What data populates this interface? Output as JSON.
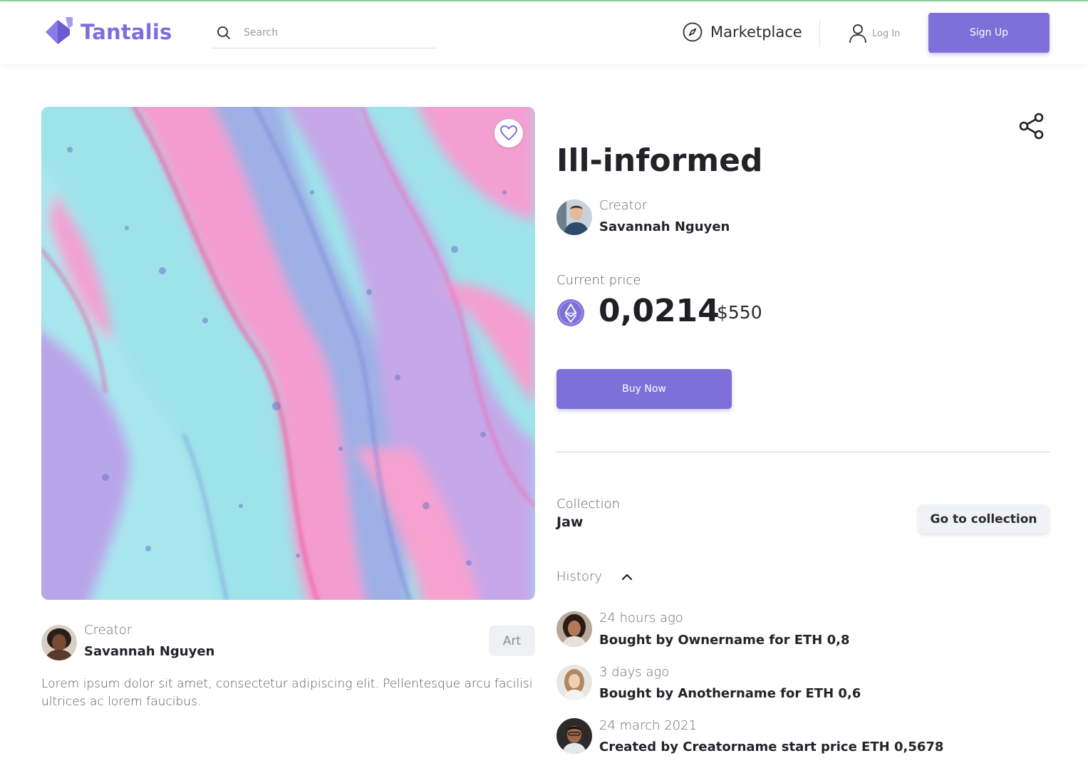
{
  "header": {
    "logo_text": "Tantalis",
    "search_placeholder": "Search",
    "nav_marketplace": "Marketplace",
    "login_label": "Log In",
    "signup_label": "Sign Up"
  },
  "artwork": {
    "favorite_icon": "heart-icon",
    "creator_label": "Creator",
    "creator_name": "Savannah Nguyen",
    "tag": "Art",
    "description": "Lorem ipsum dolor sit amet, consectetur adipiscing elit. Pellentesque arcu facilisi ultrices ac lorem faucibus."
  },
  "item": {
    "title": "Ill-informed",
    "creator_label": "Creator",
    "creator_name": "Savannah Nguyen",
    "price_label": "Current price",
    "price_eth": "0,0214",
    "price_usd": "$550",
    "buy_label": "Buy Now",
    "share_icon": "share-icon"
  },
  "collection": {
    "label": "Collection",
    "name": "Jaw",
    "goto_label": "Go to collection"
  },
  "history": {
    "label": "History",
    "entries": [
      {
        "time": "24 hours ago",
        "text": "Bought by Ownername for ETH 0,8"
      },
      {
        "time": "3 days ago",
        "text": "Bought by Anothername for ETH 0,6"
      },
      {
        "time": "24 march 2021",
        "text": "Created by Creatorname start price ETH 0,5678"
      }
    ]
  },
  "colors": {
    "accent": "#7e70d8",
    "logo": "#7d6fd9"
  }
}
